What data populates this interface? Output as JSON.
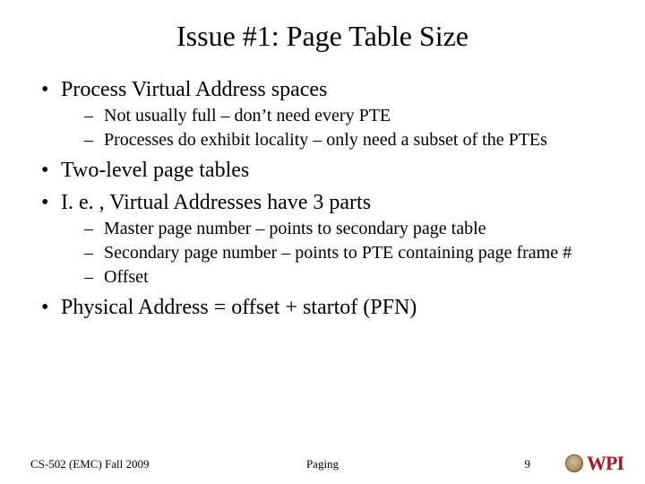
{
  "title": "Issue #1: Page Table Size",
  "bullets": {
    "b1": "Process Virtual Address spaces",
    "b1_sub1": "Not usually full – don’t need every PTE",
    "b1_sub2": "Processes do exhibit locality – only need a subset of the PTEs",
    "b2": "Two-level page tables",
    "b3": "I. e. , Virtual Addresses have 3 parts",
    "b3_sub1": "Master page number – points to secondary page table",
    "b3_sub2": "Secondary page number – points to PTE containing page frame #",
    "b3_sub3": "Offset",
    "b4": "Physical Address = offset + startof (PFN)"
  },
  "footer": {
    "left": "CS-502 (EMC) Fall 2009",
    "center": "Paging",
    "page": "9",
    "logo_text": "WPI"
  }
}
